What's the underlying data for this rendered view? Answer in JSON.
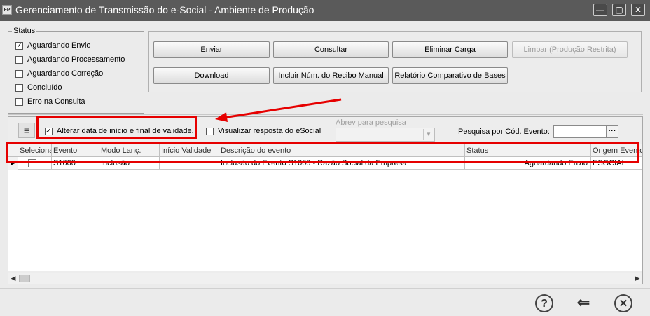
{
  "window": {
    "title": "Gerenciamento de Transmissão do e-Social - Ambiente de Produção",
    "app_icon": "FP"
  },
  "status": {
    "legend": "Status",
    "items": [
      {
        "label": "Aguardando Envio",
        "checked": true
      },
      {
        "label": "Aguardando Processamento",
        "checked": false
      },
      {
        "label": "Aguardando Correção",
        "checked": false
      },
      {
        "label": "Concluído",
        "checked": false
      },
      {
        "label": "Erro na Consulta",
        "checked": false
      }
    ]
  },
  "buttons": {
    "enviar": "Enviar",
    "consultar": "Consultar",
    "eliminar_carga": "Eliminar Carga",
    "limpar": "Limpar (Produção Restrita)",
    "download": "Download",
    "incluir_recibo": "Incluir Núm. do Recibo Manual",
    "relatorio": "Relatório Comparativo de Bases"
  },
  "options": {
    "alterar_datas": {
      "label": "Alterar data de início e final de validade.",
      "checked": true
    },
    "visualizar_resposta": {
      "label": "Visualizar resposta do eSocial",
      "checked": false
    },
    "abrev_label": "Abrev para pesquisa",
    "abrev_value": "",
    "pesquisa_label": "Pesquisa por Cód. Evento:",
    "pesquisa_value": "",
    "ellipsis": "···"
  },
  "table": {
    "columns": [
      "Seleciona",
      "Evento",
      "Modo Lanç.",
      "Início Validade",
      "Descrição do evento",
      "Status",
      "Origem Evento"
    ],
    "rows": [
      {
        "selected": false,
        "evento": "S1000",
        "modo": "Inclusão",
        "inicio": "",
        "descricao": "Inclusão do Evento S1000 - Razão Social da Empresa",
        "status": "Aguardando Envio",
        "origem": "ESOCIAL"
      }
    ]
  },
  "footer": {
    "help_icon": "help-icon",
    "back_icon": "back-arrow-icon",
    "close_icon": "close-icon"
  },
  "colors": {
    "titlebar": "#5a5a5a",
    "highlight": "#e60000"
  }
}
